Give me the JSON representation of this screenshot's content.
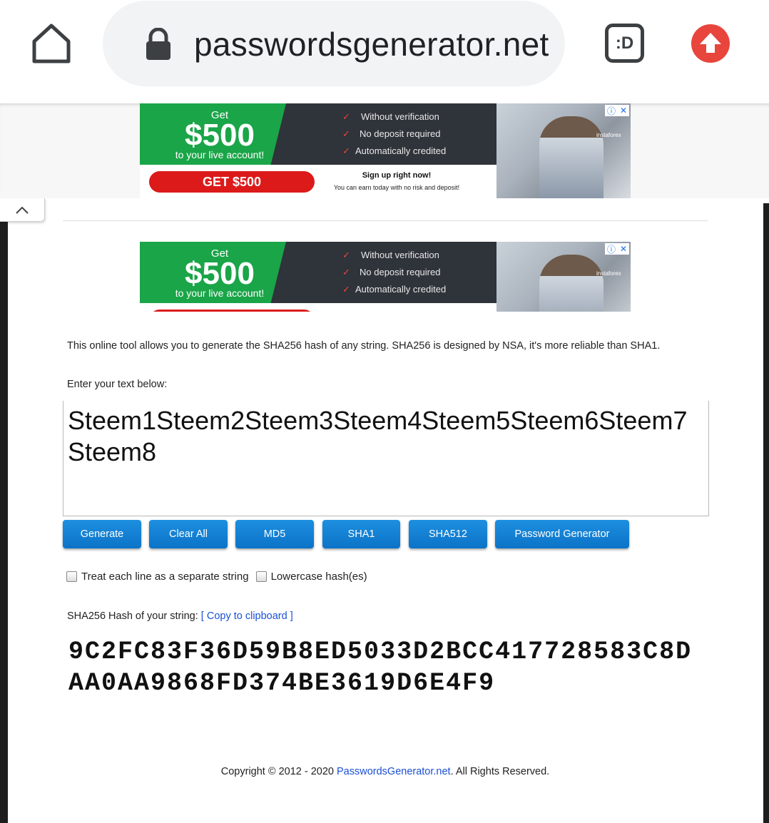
{
  "browser": {
    "url": "passwordsgenerator.net",
    "tabs_icon_label": ":D"
  },
  "ad": {
    "get": "Get",
    "amount": "$500",
    "sub": "to your live account!",
    "features": [
      "Without verification",
      "No deposit required",
      "Automatically credited"
    ],
    "cta": "GET $500",
    "signup": "Sign up right now!",
    "earn": "You can earn today with no risk and deposit!",
    "brand": "instaforex"
  },
  "content": {
    "description": "This online tool allows you to generate the SHA256 hash of any string. SHA256 is designed by NSA, it's more reliable than SHA1.",
    "enter_label": "Enter your text below:",
    "input_value": "Steem1Steem2Steem3Steem4Steem5Steem6Steem7Steem8",
    "buttons": {
      "generate": "Generate",
      "clear_all": "Clear All",
      "md5": "MD5",
      "sha1": "SHA1",
      "sha512": "SHA512",
      "password_generator": "Password Generator"
    },
    "options": {
      "separate_lines": "Treat each line as a separate string",
      "lowercase": "Lowercase hash(es)"
    },
    "hash_label": "SHA256 Hash of your string:",
    "copy_link": "[ Copy to clipboard ]",
    "hash_value": "9C2FC83F36D59B8ED5033D2BCC417728583C8DAA0AA9868FD374BE3619D6E4F9"
  },
  "footer": {
    "prefix": "Copyright © 2012 - 2020 ",
    "site": "PasswordsGenerator.net",
    "suffix": ". All Rights Reserved."
  }
}
